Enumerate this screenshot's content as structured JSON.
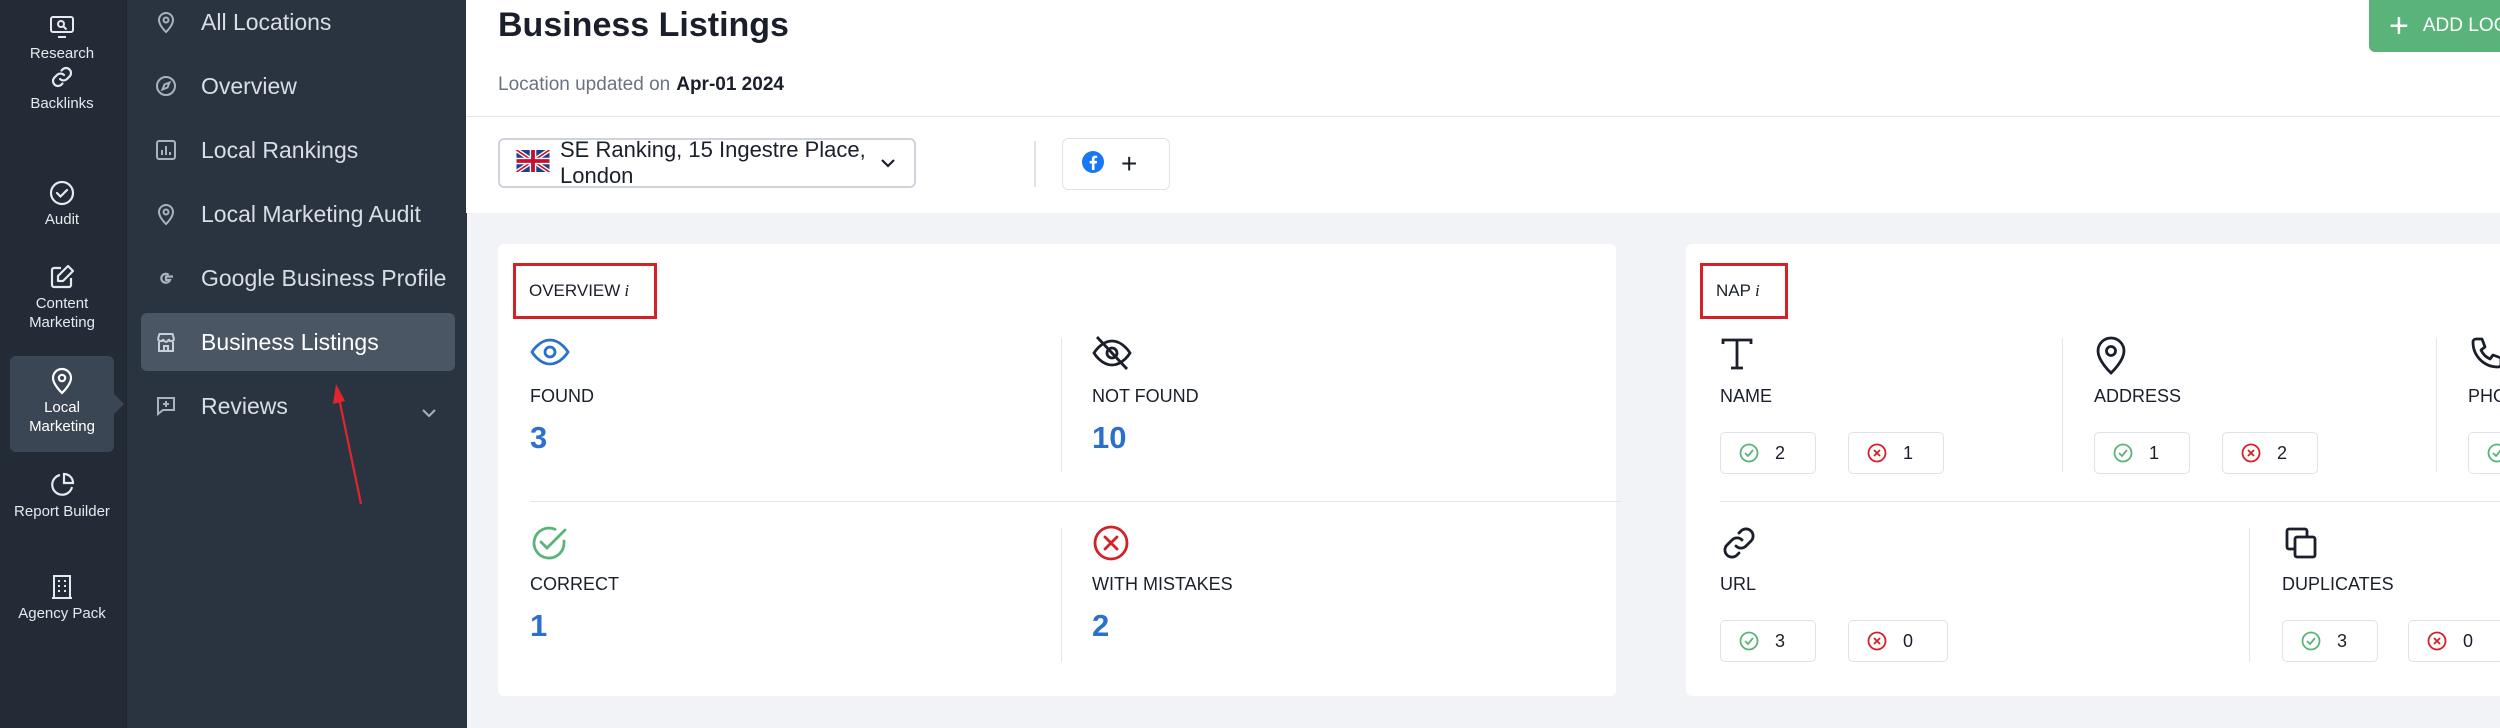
{
  "rail": {
    "items": [
      {
        "label": "Research",
        "icon": "monitor-search-icon"
      },
      {
        "label": "Backlinks",
        "icon": "link-icon"
      },
      {
        "label": "Audit",
        "icon": "check-circle-icon"
      },
      {
        "label": "Content Marketing",
        "icon": "edit-icon"
      },
      {
        "label": "Local Marketing",
        "icon": "location-pin-icon",
        "active": true
      },
      {
        "label": "Report Builder",
        "icon": "pie-chart-icon"
      },
      {
        "label": "Agency Pack",
        "icon": "building-icon"
      }
    ]
  },
  "subnav": {
    "items": [
      {
        "label": "All Locations",
        "icon": "location-pin-icon"
      },
      {
        "label": "Overview",
        "icon": "compass-icon"
      },
      {
        "label": "Local Rankings",
        "icon": "bar-chart-icon"
      },
      {
        "label": "Local Marketing Audit",
        "icon": "location-pin-icon"
      },
      {
        "label": "Google Business Profile",
        "icon": "google-icon"
      },
      {
        "label": "Business Listings",
        "icon": "store-icon",
        "active": true
      },
      {
        "label": "Reviews",
        "icon": "review-icon"
      }
    ]
  },
  "header": {
    "title": "Business Listings",
    "updated_label": "Location updated on",
    "updated_date": "Apr-01 2024",
    "add_button": "ADD LOCATION"
  },
  "toolbar": {
    "location": "SE Ranking, 15 Ingestre Place, London",
    "social_add": "+"
  },
  "overview": {
    "title": "OVERVIEW",
    "info": "i",
    "found": {
      "label": "FOUND",
      "value": "3"
    },
    "not_found": {
      "label": "NOT FOUND",
      "value": "10"
    },
    "correct": {
      "label": "CORRECT",
      "value": "1"
    },
    "with_mistakes": {
      "label": "WITH MISTAKES",
      "value": "2"
    }
  },
  "nap": {
    "title": "NAP",
    "info": "i",
    "name": {
      "label": "NAME",
      "ok": "2",
      "err": "1"
    },
    "address": {
      "label": "ADDRESS",
      "ok": "1",
      "err": "2"
    },
    "phone": {
      "label": "PHONE",
      "ok": "",
      "err": ""
    },
    "url": {
      "label": "URL",
      "ok": "3",
      "err": "0"
    },
    "duplicates": {
      "label": "DUPLICATES",
      "ok": "3",
      "err": "0"
    }
  },
  "colors": {
    "accent_blue": "#2b71c9",
    "success_green": "#5ab47a",
    "error_red": "#d42027"
  }
}
